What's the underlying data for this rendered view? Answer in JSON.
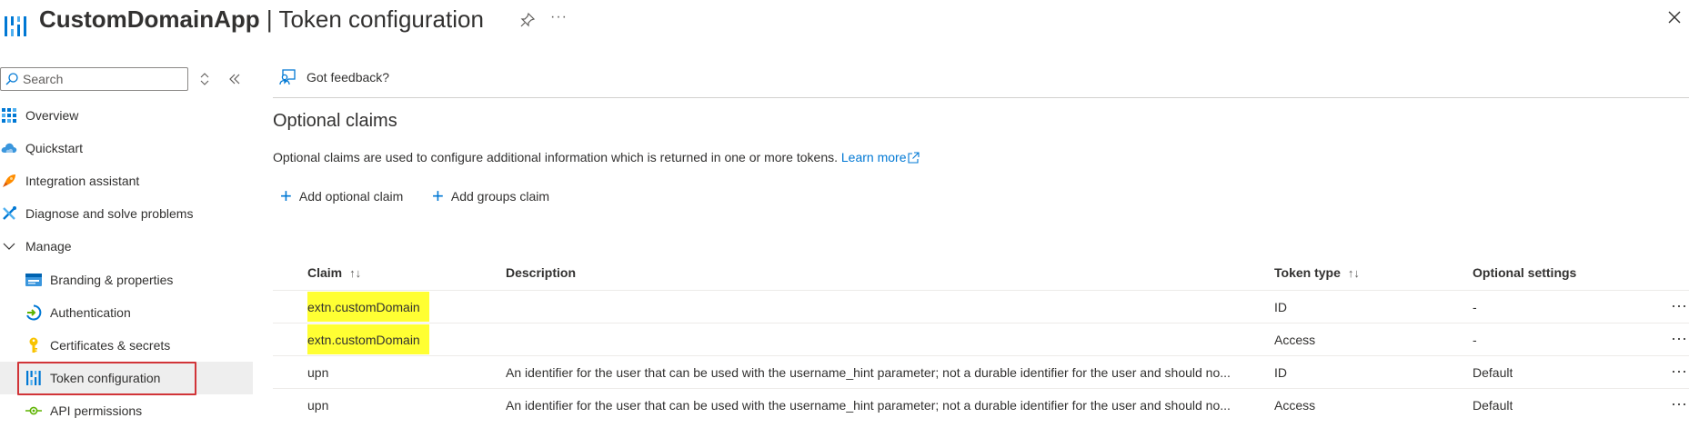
{
  "header": {
    "app_name": "CustomDomainApp",
    "separator": "|",
    "page_name": "Token configuration",
    "more_label": "···"
  },
  "sidebar": {
    "search_placeholder": "Search",
    "collapse_label": "«",
    "items": [
      {
        "label": "Overview",
        "icon": "overview-grid-icon"
      },
      {
        "label": "Quickstart",
        "icon": "cloud-icon"
      },
      {
        "label": "Integration assistant",
        "icon": "rocket-icon"
      },
      {
        "label": "Diagnose and solve problems",
        "icon": "wrench-icon"
      },
      {
        "label": "Manage",
        "icon": "chevron-down-icon"
      },
      {
        "label": "Branding & properties",
        "icon": "branding-icon"
      },
      {
        "label": "Authentication",
        "icon": "authentication-icon"
      },
      {
        "label": "Certificates & secrets",
        "icon": "key-icon"
      },
      {
        "label": "Token configuration",
        "icon": "token-bars-icon",
        "selected": true
      },
      {
        "label": "API permissions",
        "icon": "api-permissions-icon"
      }
    ]
  },
  "main": {
    "feedback_label": "Got feedback?",
    "section_title": "Optional claims",
    "section_desc": "Optional claims are used to configure additional information which is returned in one or more tokens.",
    "learn_more": "Learn more",
    "add_optional_claim": "Add optional claim",
    "add_groups_claim": "Add groups claim"
  },
  "table": {
    "columns": {
      "claim": "Claim",
      "description": "Description",
      "token_type": "Token type",
      "optional_settings": "Optional settings"
    },
    "sort_claim": "↑↓",
    "sort_token_type": "↑↓",
    "rows": [
      {
        "claim": "extn.customDomain",
        "description": "",
        "token_type": "ID",
        "optional_settings": "-",
        "highlighted": true
      },
      {
        "claim": "extn.customDomain",
        "description": "",
        "token_type": "Access",
        "optional_settings": "-",
        "highlighted": true
      },
      {
        "claim": "upn",
        "description": "An identifier for the user that can be used with the username_hint parameter; not a durable identifier for the user and should no...",
        "token_type": "ID",
        "optional_settings": "Default",
        "highlighted": false
      },
      {
        "claim": "upn",
        "description": "An identifier for the user that can be used with the username_hint parameter; not a durable identifier for the user and should no...",
        "token_type": "Access",
        "optional_settings": "Default",
        "highlighted": false
      }
    ],
    "row_more_label": "···"
  },
  "colors": {
    "accent": "#0078d4",
    "highlight": "#ffff33",
    "selected_outline": "#d13438",
    "selected_bg": "#eeeeee"
  }
}
